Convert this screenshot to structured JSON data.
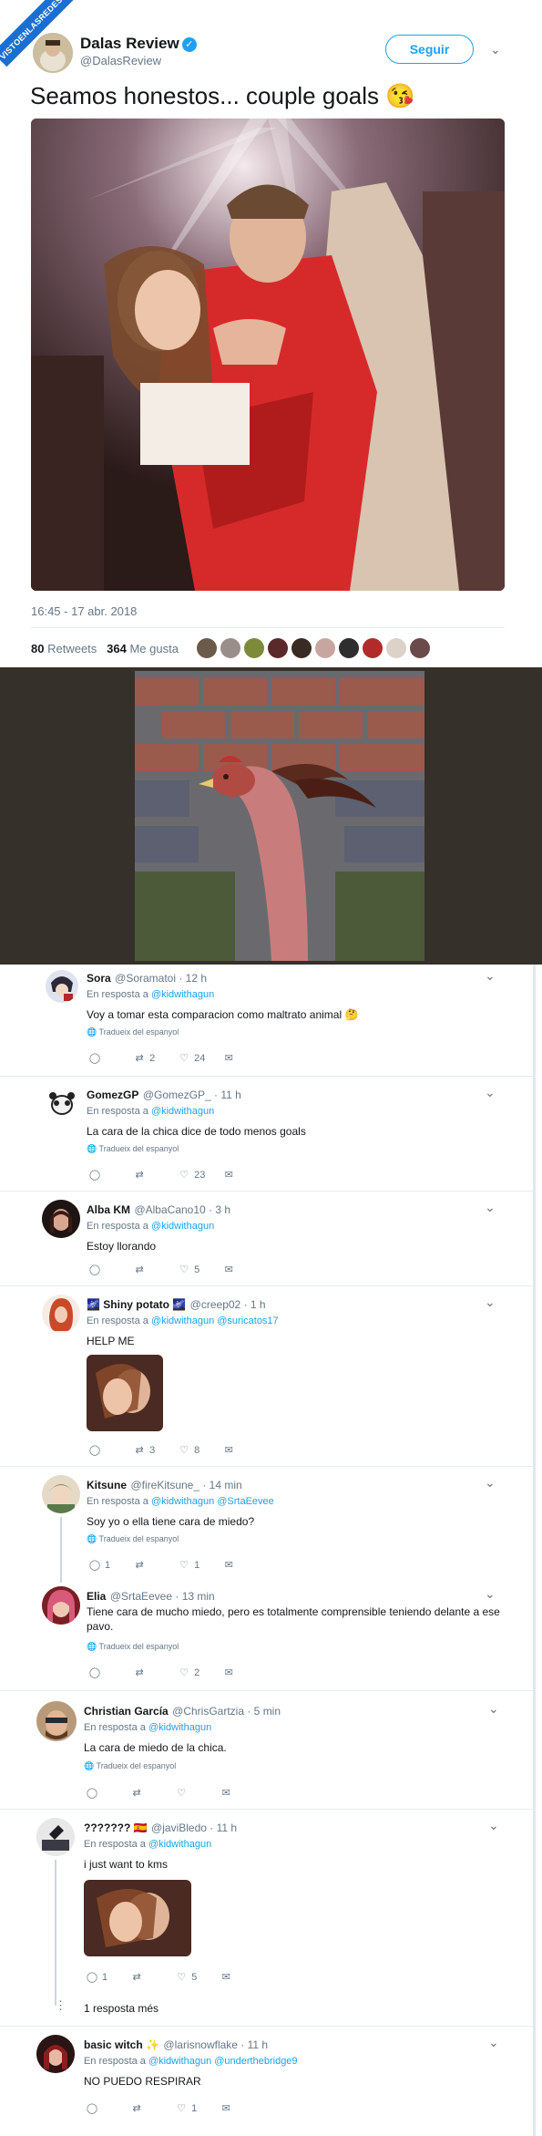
{
  "watermark": "VISTOENLASREDES.com",
  "tweet": {
    "name": "Dalas Review",
    "handle": "@DalasReview",
    "follow_label": "Seguir",
    "text": "Seamos honestos... couple goals 😘",
    "date": "16:45 - 17 abr. 2018",
    "retweets_count": "80",
    "retweets_label": "Retweets",
    "likes_count": "364",
    "likes_label": "Me gusta"
  },
  "replies": [
    {
      "name": "Sora",
      "handle": "@Soramatoi · 12 h",
      "reply_to": "En resposta a",
      "mentions": "@kidwithagun",
      "text": "Voy a tomar esta comparacion como maltrato animal 🤔",
      "translate": "Tradueix del espanyol",
      "replies": "",
      "retweets": "2",
      "likes": "24"
    },
    {
      "name": "GomezGP",
      "handle": "@GomezGP_ · 11 h",
      "reply_to": "En resposta a",
      "mentions": "@kidwithagun",
      "text": "La cara de la chica dice de todo menos goals",
      "translate": "Tradueix del espanyol",
      "replies": "",
      "retweets": "",
      "likes": "23"
    },
    {
      "name": "Alba KM",
      "handle": "@AlbaCano10 · 3 h",
      "reply_to": "En resposta a",
      "mentions": "@kidwithagun",
      "text": "Estoy llorando",
      "translate": "",
      "replies": "",
      "retweets": "",
      "likes": "5"
    },
    {
      "name": "🌌 Shiny potato 🌌",
      "handle": "@creep02 · 1 h",
      "reply_to": "En resposta a",
      "mentions": "@kidwithagun @suricatos17",
      "text": "HELP ME",
      "translate": "",
      "replies": "",
      "retweets": "3",
      "likes": "8"
    },
    {
      "name": "Kitsune",
      "handle": "@fireKitsune_ · 14 min",
      "reply_to": "En resposta a",
      "mentions": "@kidwithagun @SrtaEevee",
      "text": "Soy yo o ella tiene cara de miedo?",
      "translate": "Tradueix del espanyol",
      "replies": "1",
      "retweets": "",
      "likes": "1"
    },
    {
      "name": "Elia",
      "handle": "@SrtaEevee · 13 min",
      "reply_to": "",
      "mentions": "",
      "text": "Tiene cara de mucho miedo, pero es totalmente comprensible teniendo delante a ese pavo.",
      "translate": "Tradueix del espanyol",
      "replies": "",
      "retweets": "",
      "likes": "2"
    },
    {
      "name": "Christian García",
      "handle": "@ChrisGartzia · 5 min",
      "reply_to": "En resposta a",
      "mentions": "@kidwithagun",
      "text": "La cara de miedo de la chica.",
      "translate": "Tradueix del espanyol",
      "replies": "",
      "retweets": "",
      "likes": ""
    },
    {
      "name": "??????? 🇪🇸",
      "handle": "@javiBledo · 11 h",
      "reply_to": "En resposta a",
      "mentions": "@kidwithagun",
      "text": "i just want to kms",
      "translate": "",
      "replies": "1",
      "retweets": "",
      "likes": "5"
    },
    {
      "name": "basic witch ✨",
      "handle": "@larisnowflake · 11 h",
      "reply_to": "En resposta a",
      "mentions": "@kidwithagun @underthebridge9",
      "text": "NO PUEDO RESPIRAR",
      "translate": "",
      "replies": "",
      "retweets": "",
      "likes": "1"
    }
  ],
  "more_replies": "1 resposta més"
}
